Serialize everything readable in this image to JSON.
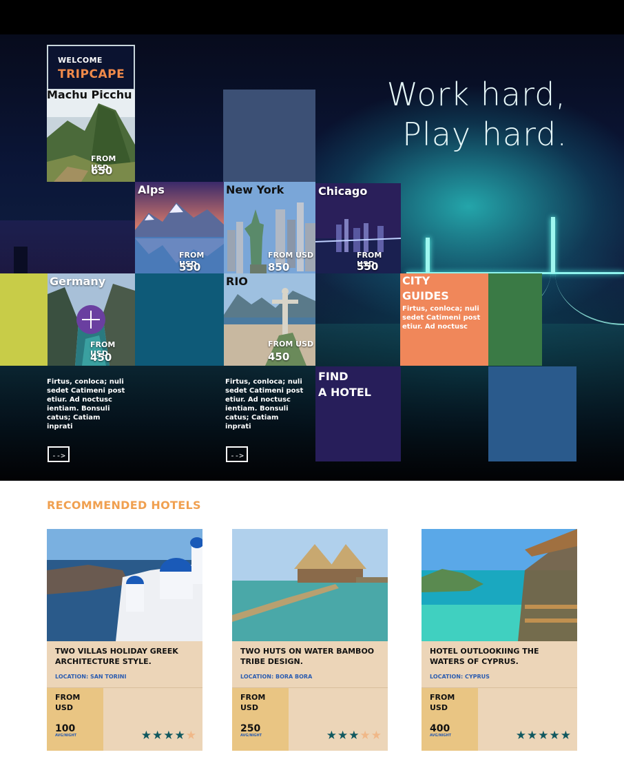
{
  "hero": {
    "slogan_line1": "Work hard,",
    "slogan_line2": "Play hard."
  },
  "welcome": {
    "line1": "WELCOME",
    "line2": "TRIPCAPE"
  },
  "destinations": [
    {
      "name": "Machu Picchu",
      "from_label": "FROM USD",
      "price": "650"
    },
    {
      "name": "Alps",
      "from_label": "FROM USD",
      "price": "550"
    },
    {
      "name": "New York",
      "from_label": "FROM USD",
      "price": "850"
    },
    {
      "name": "Chicago",
      "from_label": "FROM USD",
      "price": "550"
    },
    {
      "name": "Germany",
      "from_label": "FROM USD",
      "price": "450"
    },
    {
      "name": "RIO",
      "from_label": "FROM USD",
      "price": "450"
    }
  ],
  "city_guides": {
    "title_line1": "CITY",
    "title_line2": "GUIDES",
    "text": "Firtus, conloca; nuli sedet Catimeni post etiur. Ad noctusc"
  },
  "find_hotel": {
    "line1": "FIND",
    "line2": "A HOTEL"
  },
  "descriptions": [
    {
      "text": "Firtus, conloca; nuli sedet Catimeni post etiur. Ad noctusc ientiam. Bonsuli catus; Catiam inprati",
      "button": "-->"
    },
    {
      "text": "Firtus, conloca; nuli sedet Catimeni post etiur. Ad noctusc ientiam. Bonsuli catus; Catiam inprati",
      "button": "-->"
    }
  ],
  "recommended": {
    "title": "RECOMMENDED HOTELS",
    "hotels": [
      {
        "name": "TWO VILLAS HOLIDAY GREEK ARCHITECTURE STYLE.",
        "location": "LOCATION: SAN TORINI",
        "from": "FROM",
        "currency": "USD",
        "price": "100",
        "per": "AVG/NIGHT",
        "rating": 4
      },
      {
        "name": "TWO HUTS ON WATER BAMBOO TRIBE DESIGN.",
        "location": "LOCATION: BORA BORA",
        "from": "FROM",
        "currency": "USD",
        "price": "250",
        "per": "AVG/NIGHT",
        "rating": 3
      },
      {
        "name": "HOTEL OUTLOOKIING THE WATERS OF CYPRUS.",
        "location": "LOCATION: CYPRUS",
        "from": "FROM",
        "currency": "USD",
        "price": "400",
        "per": "AVG/NIGHT",
        "rating": 5
      }
    ]
  },
  "colors": {
    "accent_orange": "#f08a4a",
    "tile_slate": "#3c5075",
    "tile_teal": "#0e5a78",
    "tile_lime": "#c8cc48",
    "tile_green": "#3a7a45",
    "tile_purple": "#271e5a",
    "tile_blue": "#2a5a8c",
    "tile_salmon": "#f0875a",
    "star_on": "#10585f",
    "star_off": "#f0b888"
  }
}
